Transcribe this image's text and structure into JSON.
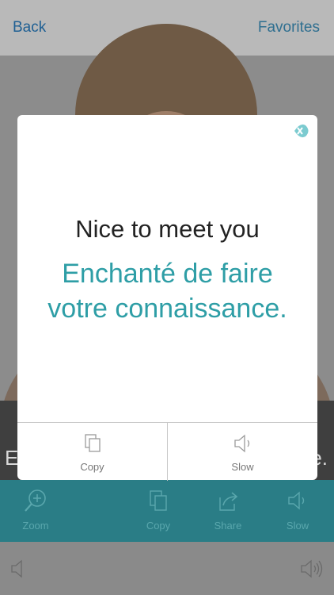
{
  "nav": {
    "back_label": "Back",
    "favorites_label": "Favorites"
  },
  "background": {
    "caption_left": "E",
    "caption_right": "e."
  },
  "modal": {
    "english": "Nice to meet you",
    "french_line1": "Enchanté de faire",
    "french_line2": "votre connaissance.",
    "actions": [
      {
        "label": "Copy",
        "icon": "copy-icon"
      },
      {
        "label": "Slow",
        "icon": "speaker-icon"
      }
    ]
  },
  "toolbar": {
    "items": [
      {
        "label": "Zoom",
        "icon": "zoom-icon"
      },
      {
        "label": "Copy",
        "icon": "copy-icon"
      },
      {
        "label": "Share",
        "icon": "share-icon"
      },
      {
        "label": "Slow",
        "icon": "speaker-icon"
      }
    ]
  },
  "colors": {
    "accent": "#2e9ea6",
    "toolbar": "#2a7d86",
    "nav_link": "#1e5f93"
  }
}
